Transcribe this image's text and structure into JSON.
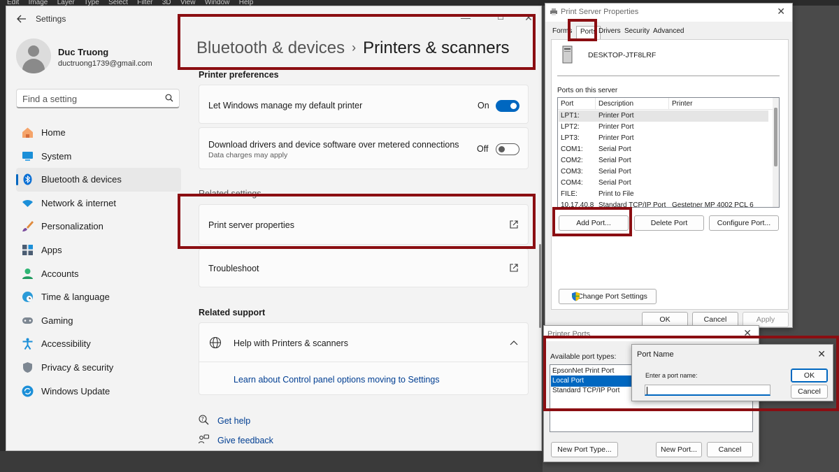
{
  "bg_menu": [
    "Edit",
    "Image",
    "Layer",
    "Type",
    "Select",
    "Filter",
    "3D",
    "View",
    "Window",
    "Help"
  ],
  "settings": {
    "app_title": "Settings",
    "window_controls": [
      "—",
      "☐",
      "✕"
    ],
    "profile": {
      "name": "Duc Truong",
      "email": "ductruong1739@gmail.com"
    },
    "search_placeholder": "Find a setting",
    "nav": [
      {
        "label": "Home",
        "icon": "home-icon"
      },
      {
        "label": "System",
        "icon": "system-icon"
      },
      {
        "label": "Bluetooth & devices",
        "icon": "bluetooth-icon",
        "active": true
      },
      {
        "label": "Network & internet",
        "icon": "wifi-icon"
      },
      {
        "label": "Personalization",
        "icon": "brush-icon"
      },
      {
        "label": "Apps",
        "icon": "apps-icon"
      },
      {
        "label": "Accounts",
        "icon": "accounts-icon"
      },
      {
        "label": "Time & language",
        "icon": "globe-clock-icon"
      },
      {
        "label": "Gaming",
        "icon": "gamepad-icon"
      },
      {
        "label": "Accessibility",
        "icon": "accessibility-icon"
      },
      {
        "label": "Privacy & security",
        "icon": "shield-icon"
      },
      {
        "label": "Windows Update",
        "icon": "update-icon"
      }
    ],
    "breadcrumb": {
      "parent": "Bluetooth & devices",
      "separator": "›",
      "current": "Printers & scanners"
    },
    "printer_preferences": {
      "title": "Printer preferences",
      "default_printer": {
        "label": "Let Windows manage my default printer",
        "state": "On"
      },
      "metered": {
        "label": "Download drivers and device software over metered connections",
        "sub": "Data charges may apply",
        "state": "Off"
      }
    },
    "related_settings": {
      "title": "Related settings",
      "print_server": "Print server properties",
      "troubleshoot": "Troubleshoot"
    },
    "related_support": {
      "title": "Related support",
      "help_header": "Help with Printers & scanners",
      "help_link": "Learn about Control panel options moving to Settings"
    },
    "footer": {
      "get_help": "Get help",
      "feedback": "Give feedback"
    }
  },
  "print_server": {
    "title": "Print Server Properties",
    "tabs": [
      "Forms",
      "Ports",
      "Drivers",
      "Security",
      "Advanced"
    ],
    "active_tab": "Ports",
    "computer_name": "DESKTOP-JTF8LRF",
    "ports_label": "Ports on this server",
    "columns": [
      "Port",
      "Description",
      "Printer"
    ],
    "ports": [
      {
        "port": "LPT1:",
        "description": "Printer Port",
        "printer": ""
      },
      {
        "port": "LPT2:",
        "description": "Printer Port",
        "printer": ""
      },
      {
        "port": "LPT3:",
        "description": "Printer Port",
        "printer": ""
      },
      {
        "port": "COM1:",
        "description": "Serial Port",
        "printer": ""
      },
      {
        "port": "COM2:",
        "description": "Serial Port",
        "printer": ""
      },
      {
        "port": "COM3:",
        "description": "Serial Port",
        "printer": ""
      },
      {
        "port": "COM4:",
        "description": "Serial Port",
        "printer": ""
      },
      {
        "port": "FILE:",
        "description": "Print to File",
        "printer": ""
      },
      {
        "port": "10.17.40.8",
        "description": "Standard TCP/IP Port",
        "printer": "Gestetner MP 4002 PCL 6"
      }
    ],
    "buttons": {
      "add": "Add Port...",
      "delete": "Delete Port",
      "configure": "Configure Port...",
      "change": "Change Port Settings",
      "ok": "OK",
      "cancel": "Cancel",
      "apply": "Apply"
    }
  },
  "printer_ports": {
    "title": "Printer Ports",
    "available_label": "Available port types:",
    "types": [
      "EpsonNet Print Port",
      "Local Port",
      "Standard TCP/IP Port"
    ],
    "selected": "Local Port",
    "buttons": {
      "new_type": "New Port Type...",
      "new_port": "New Port...",
      "cancel": "Cancel"
    }
  },
  "port_name": {
    "title": "Port Name",
    "prompt": "Enter a port name:",
    "value": "",
    "buttons": {
      "ok": "OK",
      "cancel": "Cancel"
    }
  },
  "colors": {
    "accent": "#0067c0",
    "link": "#003e92",
    "highlight": "#8b0e12"
  }
}
